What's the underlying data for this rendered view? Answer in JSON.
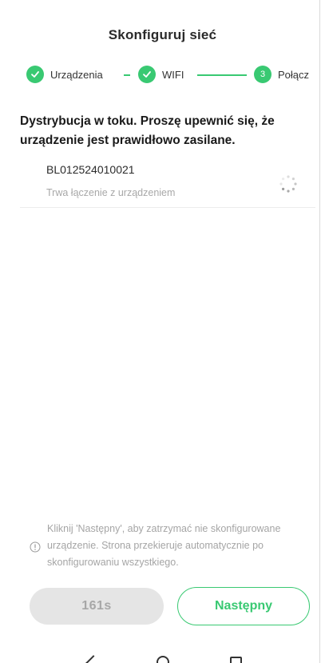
{
  "header": {
    "title": "Skonfiguruj sieć"
  },
  "steps": [
    {
      "label": "Urządzenia",
      "state": "done"
    },
    {
      "label": "WIFI",
      "state": "done"
    },
    {
      "number": "3",
      "label": "Połącz",
      "state": "active"
    }
  ],
  "main": {
    "heading": "Dystrybucja w toku. Proszę upewnić się, że urządzenie jest prawidłowo zasilane.",
    "device": {
      "id": "BL012524010021",
      "status": "Trwa łączenie z urządzeniem"
    }
  },
  "notice": {
    "text": "Kliknij 'Następny', aby zatrzymać nie skonfigurowane urządzenie. Strona przekieruje automatycznie po skonfigurowaniu wszystkiego."
  },
  "buttons": {
    "timer_label": "161s",
    "next_label": "Następny"
  },
  "colors": {
    "accent": "#39c972",
    "disabled_bg": "#e5e5e5",
    "muted_text": "#a8a8a8"
  },
  "icons": [
    "check-icon",
    "spinner-icon",
    "info-icon",
    "nav-back-icon",
    "nav-home-icon",
    "nav-recent-icon"
  ]
}
